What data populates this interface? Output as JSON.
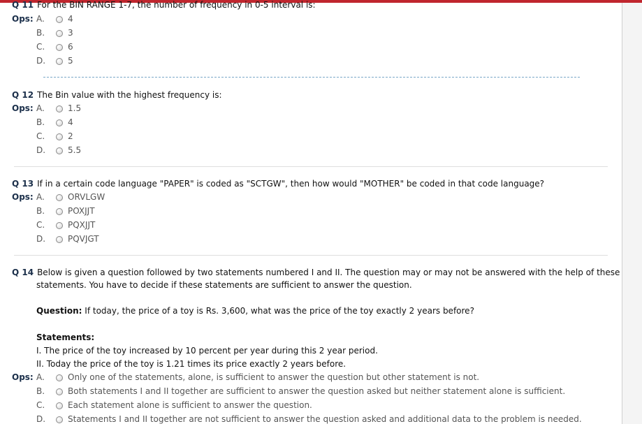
{
  "questions": [
    {
      "number": "Q 11",
      "text": "For the BIN RANGE 1-7, the number of frequency in 0-5 interval is:",
      "ops_label": "Ops:",
      "options": [
        {
          "letter": "A.",
          "text": "4"
        },
        {
          "letter": "B.",
          "text": "3"
        },
        {
          "letter": "C.",
          "text": "6"
        },
        {
          "letter": "D.",
          "text": "5"
        }
      ]
    },
    {
      "number": "Q 12",
      "text": "The Bin value with the highest frequency is:",
      "ops_label": "Ops:",
      "options": [
        {
          "letter": "A.",
          "text": "1.5"
        },
        {
          "letter": "B.",
          "text": "4"
        },
        {
          "letter": "C.",
          "text": "2"
        },
        {
          "letter": "D.",
          "text": "5.5"
        }
      ]
    },
    {
      "number": "Q 13",
      "text": "If in a certain code language \"PAPER\" is coded as \"SCTGW\", then how would \"MOTHER\" be coded in that code language?",
      "ops_label": "Ops:",
      "options": [
        {
          "letter": "A.",
          "text": "ORVLGW"
        },
        {
          "letter": "B.",
          "text": "POXJJT"
        },
        {
          "letter": "C.",
          "text": "PQXJJT"
        },
        {
          "letter": "D.",
          "text": "PQVJGT"
        }
      ]
    },
    {
      "number": "Q 14",
      "text_line1": "Below is given a question followed by two statements numbered I and II. The question may or may not be answered with the help of these",
      "text_line2": "statements. You have to decide if these statements are sufficient to answer the question.",
      "question_label": "Question:",
      "question_text": " If today, the price of a toy is Rs. 3,600, what was the price of the toy exactly 2 years before?",
      "statements_label": "Statements:",
      "statement1": "I. The price of the toy increased by 10 percent per year during this 2 year period.",
      "statement2": "II. Today the price of the toy is 1.21 times its price exactly 2 years before.",
      "ops_label": "Ops:",
      "options": [
        {
          "letter": "A.",
          "text": "Only one of the statements, alone, is sufficient to answer the question but other statement is not."
        },
        {
          "letter": "B.",
          "text": "Both statements I and II together are sufficient to answer the question asked but neither statement alone is sufficient."
        },
        {
          "letter": "C.",
          "text": "Each statement alone is sufficient to answer the question."
        },
        {
          "letter": "D.",
          "text": "Statements I and II together are not sufficient to answer the question asked and additional data to the problem is needed."
        }
      ]
    }
  ]
}
